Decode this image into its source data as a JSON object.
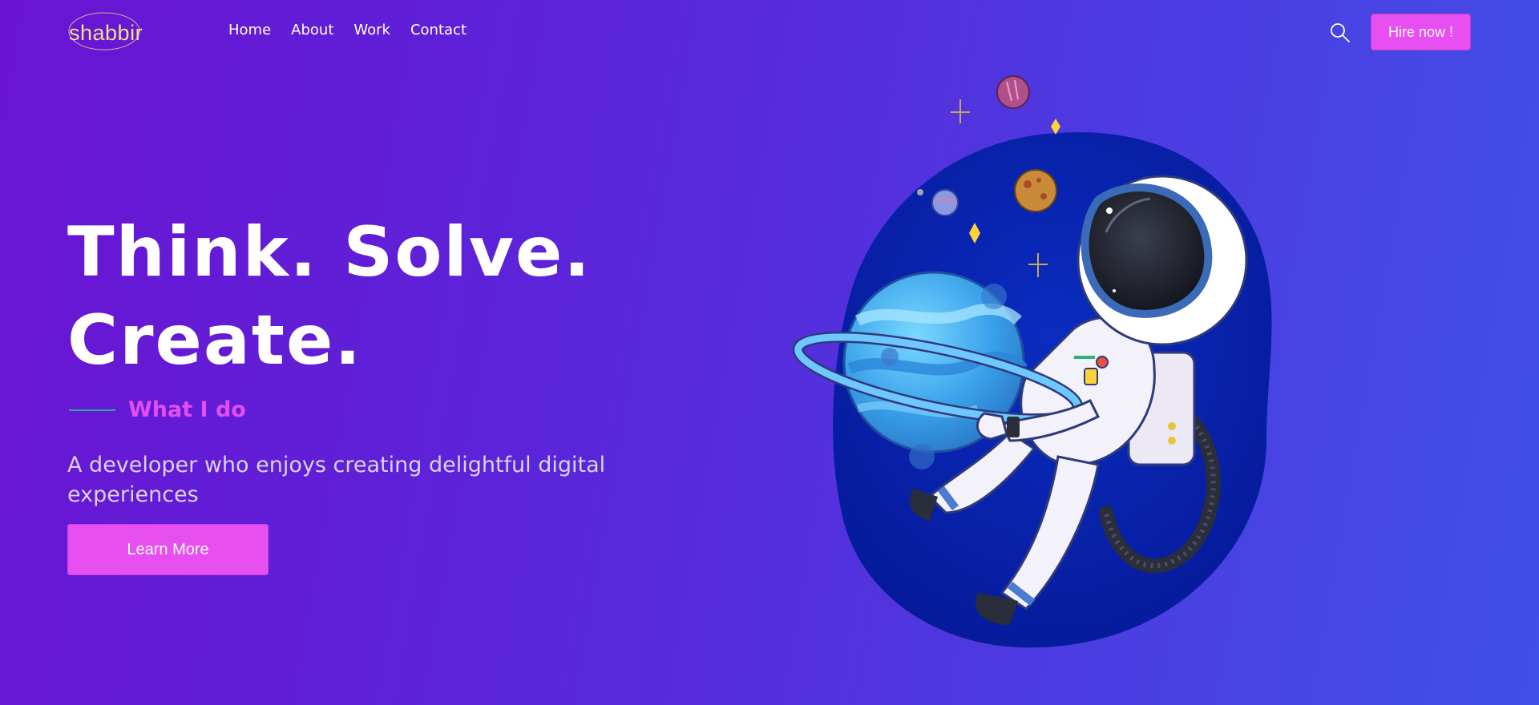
{
  "brand": {
    "logo_text": "shabbir",
    "logo_color": "#f0e08a"
  },
  "nav": {
    "items": [
      {
        "label": "Home"
      },
      {
        "label": "About"
      },
      {
        "label": "Work"
      },
      {
        "label": "Contact"
      }
    ],
    "search_icon": "search-icon",
    "hire_label": "Hire now !"
  },
  "hero": {
    "headline_line1": "Think. Solve.",
    "headline_line2": "Create.",
    "eyebrow": "What I do",
    "description": "A developer who enjoys creating delightful digital experiences",
    "cta_label": "Learn More"
  },
  "colors": {
    "accent": "#e84ff0",
    "eyebrow_line": "#2fa39a",
    "background_start": "#6a14d2",
    "background_end": "#4150e6"
  },
  "illustration": {
    "subject": "astronaut-holding-planet"
  }
}
